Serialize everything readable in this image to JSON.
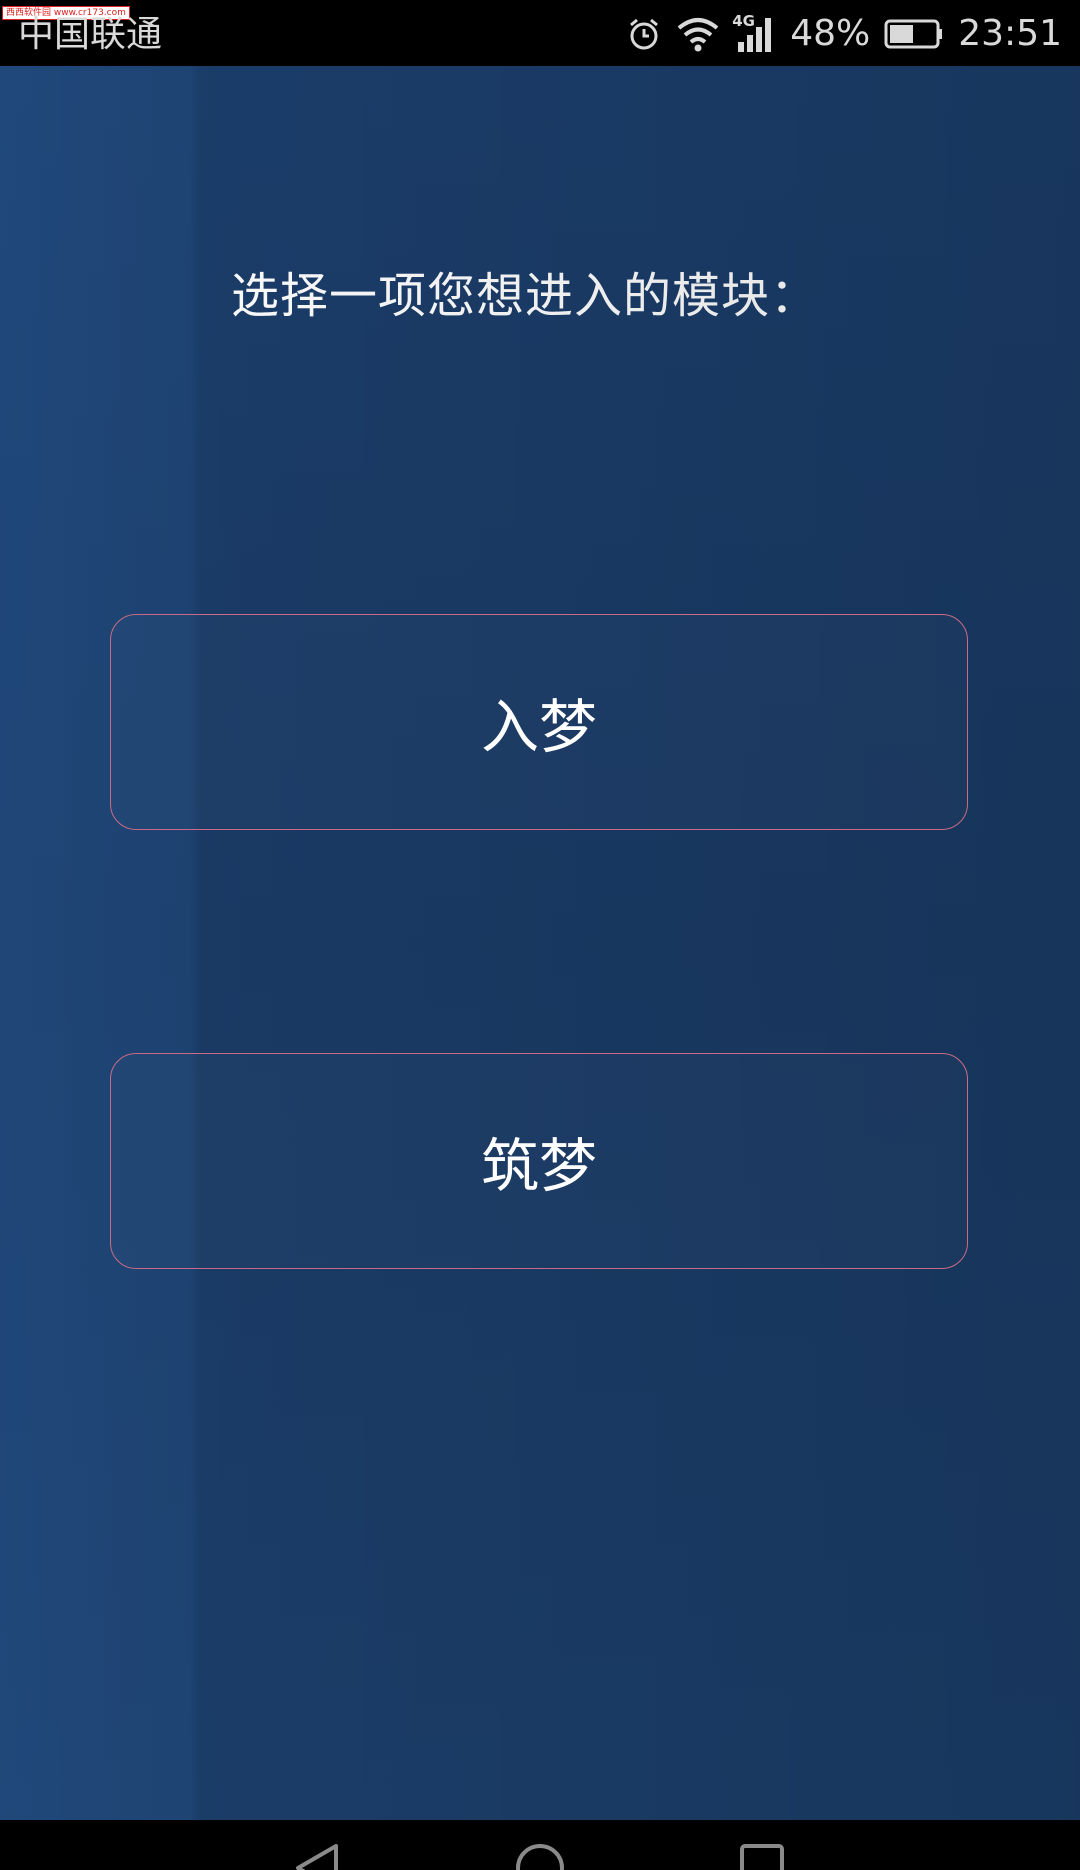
{
  "status_bar": {
    "watermark": "西西软件园 www.cr173.com",
    "carrier": "中国联通",
    "network_type": "4G",
    "battery_percent": "48%",
    "time": "23:51",
    "icons": [
      "alarm-icon",
      "wifi-icon",
      "signal-icon",
      "battery-icon"
    ]
  },
  "main": {
    "prompt": "选择一项您想进入的模块：",
    "buttons": [
      {
        "label": "入梦"
      },
      {
        "label": "筑梦"
      }
    ]
  },
  "nav_bar": {
    "icons": [
      "back-icon",
      "home-icon",
      "recent-apps-icon"
    ]
  },
  "colors": {
    "background": "#1a3b66",
    "button_border": "#c96b86",
    "text": "#ffffff",
    "status_bar": "#000000"
  }
}
